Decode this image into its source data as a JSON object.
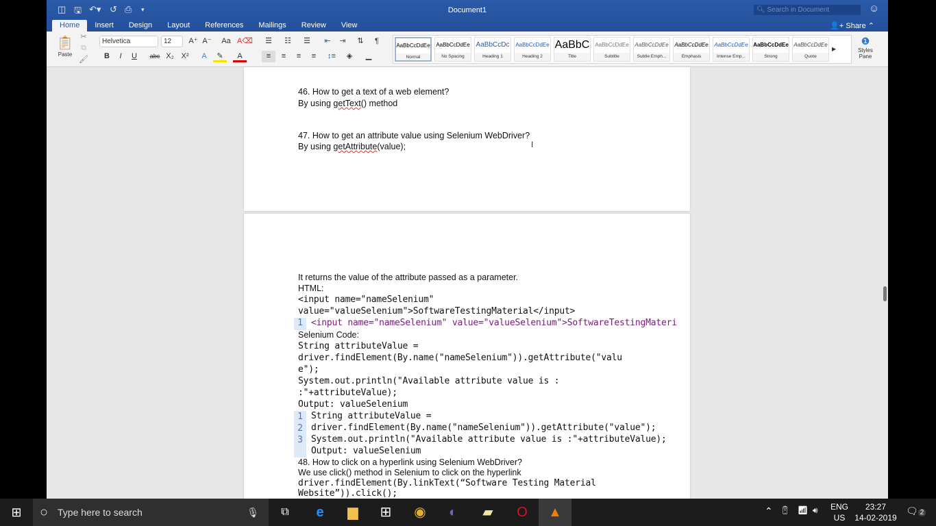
{
  "window": {
    "title": "Document1",
    "search_placeholder": "Search in Document",
    "share": "Share"
  },
  "tabs": [
    "Home",
    "Insert",
    "Design",
    "Layout",
    "References",
    "Mailings",
    "Review",
    "View"
  ],
  "ribbon": {
    "paste": "Paste",
    "font": "Helvetica",
    "size": "12",
    "styles_pane": "Styles Pane",
    "styles": [
      {
        "preview": "AaBbCcDdEe",
        "name": "Normal"
      },
      {
        "preview": "AaBbCcDdEe",
        "name": "No Spacing"
      },
      {
        "preview": "AaBbCcDc",
        "name": "Heading 1"
      },
      {
        "preview": "AaBbCcDdEe",
        "name": "Heading 2"
      },
      {
        "preview": "AaBbC",
        "name": "Title"
      },
      {
        "preview": "AaBbCcDdEe",
        "name": "Subtitle"
      },
      {
        "preview": "AaBbCcDdEe",
        "name": "Subtle Emph..."
      },
      {
        "preview": "AaBbCcDdEe",
        "name": "Emphasis"
      },
      {
        "preview": "AaBbCcDdEe",
        "name": "Intense Emp..."
      },
      {
        "preview": "AaBbCcDdEe",
        "name": "Strong"
      },
      {
        "preview": "AaBbCcDdEe",
        "name": "Quote"
      }
    ]
  },
  "page1": {
    "q46": "46. How to get a text of a web element?",
    "a46_pre": "By using ",
    "a46_fn": "getText",
    "a46_post": "() method",
    "q47": "47. How to get an attribute value using Selenium WebDriver?",
    "a47_pre": "By using ",
    "a47_fn": "getAttribute",
    "a47_post": "(value);"
  },
  "page2": {
    "l1": "It returns the value of the attribute passed as a parameter.",
    "l2": "HTML:",
    "l3": "<input name=\"nameSelenium\"",
    "l4": "value=\"valueSelenium\">SoftwareTestingMaterial</input>",
    "c1": "<input name=\"nameSelenium\" value=\"valueSelenium\">SoftwareTestingMateri",
    "l5": "Selenium Code:",
    "l6": "String attributeValue =",
    "l7": "driver.findElement(By.name(\"nameSelenium\")).getAttribute(\"valu",
    "l8": "e\");",
    "l9": "System.out.println(\"Available attribute value is :",
    "l10": ":\"+attributeValue);",
    "l11": "Output: valueSelenium",
    "code": [
      "String attributeValue =",
      "driver.findElement(By.name(\"nameSelenium\")).getAttribute(\"value\");",
      "System.out.println(\"Available attribute value is :\"+attributeValue);",
      "Output: valueSelenium"
    ],
    "line_numbers": [
      "1",
      "2",
      "3"
    ],
    "q48": "48. How to click on a hyperlink using Selenium WebDriver?",
    "a48": "We use click() method in Selenium to click on the hyperlink",
    "l12": "driver.findElement(By.linkText(“Software Testing Material",
    "l13": "Website”)).click();"
  },
  "taskbar": {
    "search_placeholder": "Type here to search",
    "lang1": "ENG",
    "lang2": "US",
    "time": "23:27",
    "date": "14-02-2019",
    "notifications": "2"
  }
}
